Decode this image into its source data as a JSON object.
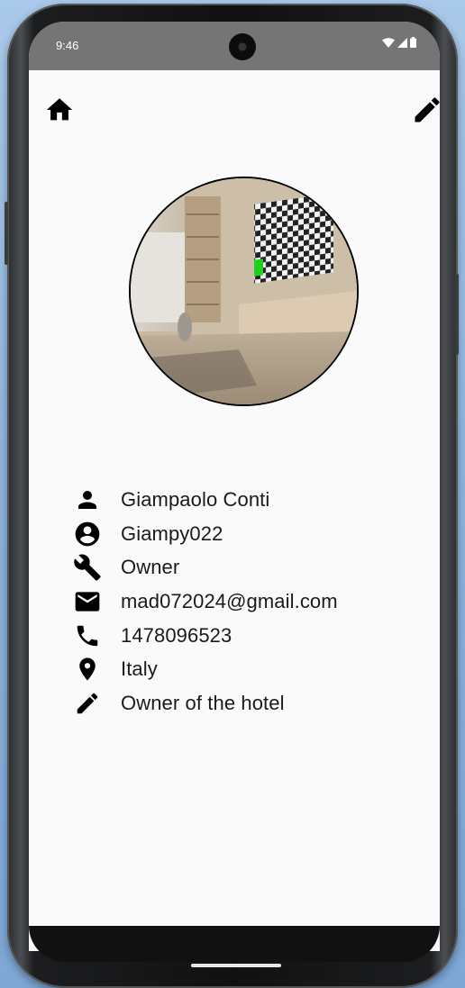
{
  "status_bar": {
    "time": "9:46",
    "icons": [
      "wifi-icon",
      "signal-icon",
      "battery-icon"
    ]
  },
  "toolbar": {
    "home_icon": "home-icon",
    "edit_icon": "edit-pencil-icon"
  },
  "profile": {
    "avatar": "profile-photo",
    "fields": [
      {
        "icon": "person-icon",
        "value": "Giampaolo Conti"
      },
      {
        "icon": "account-circle-icon",
        "value": "Giampy022"
      },
      {
        "icon": "wrench-icon",
        "value": "Owner"
      },
      {
        "icon": "mail-icon",
        "value": "mad072024@gmail.com"
      },
      {
        "icon": "phone-icon",
        "value": "1478096523"
      },
      {
        "icon": "location-pin-icon",
        "value": "Italy"
      },
      {
        "icon": "pencil-icon",
        "value": "Owner of the hotel"
      }
    ]
  },
  "colors": {
    "status_bar": "#757575",
    "screen_bg": "#fafafa",
    "icon": "#000000"
  }
}
